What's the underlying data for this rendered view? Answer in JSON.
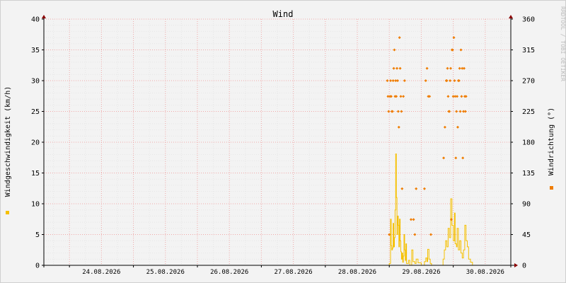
{
  "chart_data": {
    "type": "line",
    "title": "Wind",
    "ylabel_left": "Windgeschwindigkeit (km/h)",
    "ylabel_right": "Windrichtung (°)",
    "watermark": "RRDTOOL / TOBI OETIKER",
    "y_left": {
      "min": 0,
      "max": 40,
      "ticks": [
        0,
        5,
        10,
        15,
        20,
        25,
        30,
        35,
        40
      ]
    },
    "y_right": {
      "min": 0,
      "max": 360,
      "ticks": [
        0,
        45,
        90,
        135,
        180,
        225,
        270,
        315,
        360
      ]
    },
    "x_tick_labels": [
      "24.08.2026",
      "25.08.2026",
      "26.08.2026",
      "27.08.2026",
      "28.08.2026",
      "29.08.2026",
      "30.08.2026"
    ],
    "x_range_days": [
      23.6,
      30.9
    ],
    "grid": true,
    "colors": {
      "speed": "#f5c000",
      "direction": "#ef7d00",
      "grid": "#f0a8a8",
      "axis": "#000000",
      "bg": "#f3f3f3"
    },
    "series": [
      {
        "key": "speed",
        "axis": "left",
        "points": [
          [
            29.0,
            0.3
          ],
          [
            29.02,
            7.5
          ],
          [
            29.03,
            3.2
          ],
          [
            29.04,
            2.5
          ],
          [
            29.05,
            2.8
          ],
          [
            29.06,
            6.8
          ],
          [
            29.07,
            3.0
          ],
          [
            29.08,
            4.5
          ],
          [
            29.09,
            9.0
          ],
          [
            29.1,
            18.1
          ],
          [
            29.11,
            11.0
          ],
          [
            29.12,
            5.0
          ],
          [
            29.13,
            8.0
          ],
          [
            29.14,
            6.5
          ],
          [
            29.15,
            3.0
          ],
          [
            29.16,
            7.5
          ],
          [
            29.17,
            4.0
          ],
          [
            29.18,
            2.2
          ],
          [
            29.19,
            1.0
          ],
          [
            29.2,
            2.0
          ],
          [
            29.21,
            0.5
          ],
          [
            29.22,
            1.5
          ],
          [
            29.23,
            5.0
          ],
          [
            29.24,
            2.5
          ],
          [
            29.25,
            0.8
          ],
          [
            29.26,
            3.5
          ],
          [
            29.27,
            0.3
          ],
          [
            29.3,
            0.8
          ],
          [
            29.32,
            0.0
          ],
          [
            29.35,
            2.5
          ],
          [
            29.37,
            0.6
          ],
          [
            29.4,
            0.3
          ],
          [
            29.42,
            1.0
          ],
          [
            29.45,
            0.4
          ],
          [
            29.5,
            0.0
          ],
          [
            29.55,
            0.6
          ],
          [
            29.57,
            1.2
          ],
          [
            29.59,
            0.6
          ],
          [
            29.6,
            2.6
          ],
          [
            29.62,
            1.0
          ],
          [
            29.64,
            0.3
          ],
          [
            29.66,
            0.0
          ],
          [
            29.7,
            0.0
          ],
          [
            29.8,
            0.0
          ],
          [
            29.84,
            1.0
          ],
          [
            29.86,
            2.5
          ],
          [
            29.88,
            4.0
          ],
          [
            29.9,
            3.0
          ],
          [
            29.92,
            6.0
          ],
          [
            29.94,
            4.5
          ],
          [
            29.96,
            10.8
          ],
          [
            29.98,
            6.5
          ],
          [
            30.0,
            4.0
          ],
          [
            30.02,
            8.5
          ],
          [
            30.03,
            3.5
          ],
          [
            30.05,
            3.0
          ],
          [
            30.06,
            6.0
          ],
          [
            30.08,
            2.5
          ],
          [
            30.1,
            4.0
          ],
          [
            30.12,
            2.0
          ],
          [
            30.14,
            1.2
          ],
          [
            30.16,
            2.5
          ],
          [
            30.18,
            6.5
          ],
          [
            30.2,
            4.0
          ],
          [
            30.22,
            3.0
          ],
          [
            30.24,
            1.0
          ],
          [
            30.27,
            0.5
          ],
          [
            30.3,
            0.0
          ]
        ]
      },
      {
        "key": "direction",
        "axis": "right",
        "points": [
          [
            28.97,
            270
          ],
          [
            28.98,
            247
          ],
          [
            28.99,
            225
          ],
          [
            29.0,
            45
          ],
          [
            29.01,
            247
          ],
          [
            29.02,
            270
          ],
          [
            29.03,
            247
          ],
          [
            29.04,
            225
          ],
          [
            29.05,
            225
          ],
          [
            29.06,
            270
          ],
          [
            29.07,
            288
          ],
          [
            29.08,
            315
          ],
          [
            29.09,
            247
          ],
          [
            29.1,
            270
          ],
          [
            29.11,
            247
          ],
          [
            29.12,
            288
          ],
          [
            29.13,
            270
          ],
          [
            29.14,
            225
          ],
          [
            29.15,
            202
          ],
          [
            29.16,
            333
          ],
          [
            29.17,
            288
          ],
          [
            29.18,
            247
          ],
          [
            29.19,
            225
          ],
          [
            29.2,
            112
          ],
          [
            29.22,
            247
          ],
          [
            29.24,
            270
          ],
          [
            29.34,
            67
          ],
          [
            29.38,
            67
          ],
          [
            29.4,
            45
          ],
          [
            29.42,
            112
          ],
          [
            29.55,
            112
          ],
          [
            29.57,
            270
          ],
          [
            29.59,
            288
          ],
          [
            29.61,
            247
          ],
          [
            29.63,
            247
          ],
          [
            29.65,
            45
          ],
          [
            29.85,
            157
          ],
          [
            29.87,
            202
          ],
          [
            29.89,
            270
          ],
          [
            29.9,
            270
          ],
          [
            29.91,
            288
          ],
          [
            29.92,
            247
          ],
          [
            29.93,
            225
          ],
          [
            29.94,
            225
          ],
          [
            29.95,
            270
          ],
          [
            29.96,
            288
          ],
          [
            29.97,
            67
          ],
          [
            29.98,
            315
          ],
          [
            29.99,
            315
          ],
          [
            30.0,
            247
          ],
          [
            30.01,
            333
          ],
          [
            30.02,
            270
          ],
          [
            30.03,
            247
          ],
          [
            30.04,
            157
          ],
          [
            30.05,
            225
          ],
          [
            30.06,
            247
          ],
          [
            30.07,
            202
          ],
          [
            30.08,
            270
          ],
          [
            30.09,
            270
          ],
          [
            30.1,
            288
          ],
          [
            30.11,
            225
          ],
          [
            30.12,
            315
          ],
          [
            30.13,
            247
          ],
          [
            30.14,
            288
          ],
          [
            30.15,
            157
          ],
          [
            30.16,
            225
          ],
          [
            30.17,
            288
          ],
          [
            30.18,
            247
          ],
          [
            30.19,
            225
          ],
          [
            30.2,
            247
          ]
        ]
      }
    ]
  }
}
